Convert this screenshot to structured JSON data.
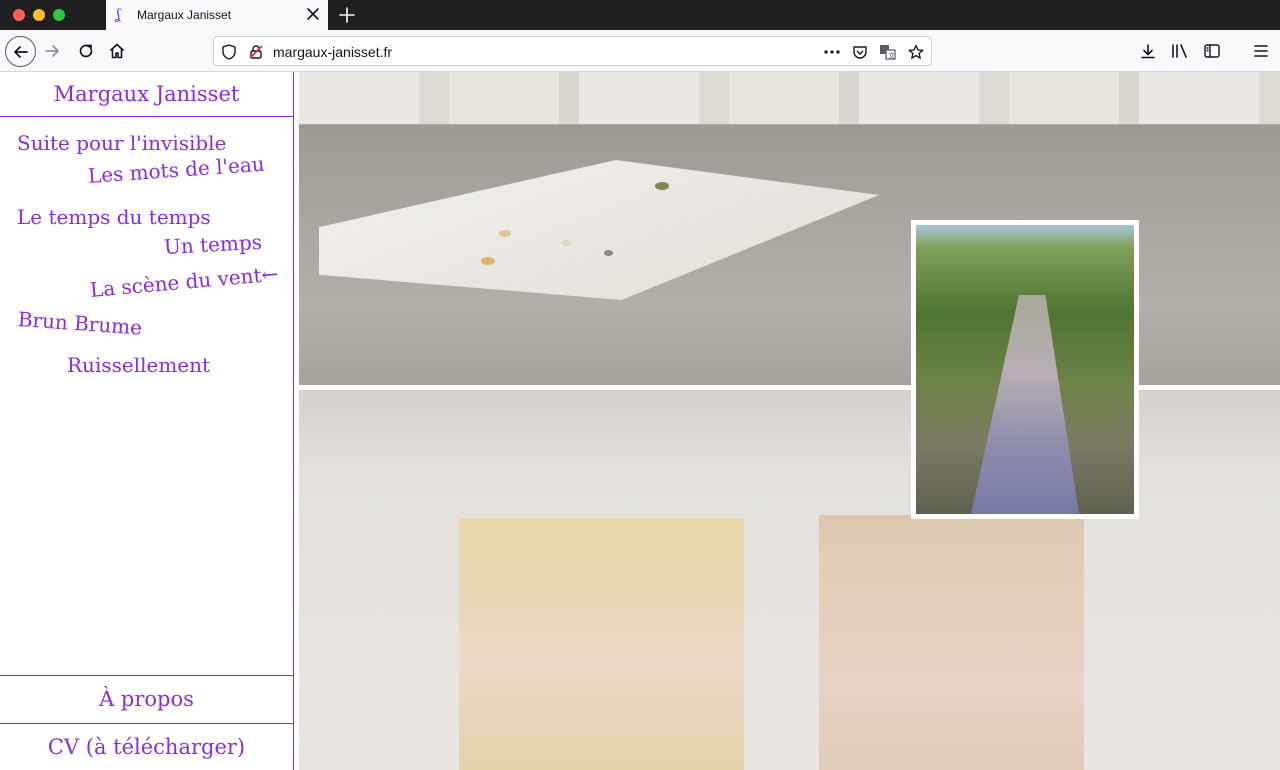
{
  "browser": {
    "tab_title": "Margaux Janisset",
    "url": "margaux-janisset.fr"
  },
  "site": {
    "title": "Margaux Janisset",
    "menu": [
      "Suite pour l'invisible",
      "Les mots de l'eau",
      "Le temps du temps",
      "Un temps",
      "La scène du vent←",
      "Brun Brume",
      "Ruissellement"
    ],
    "about": "À propos",
    "cv": "CV (à télécharger)"
  },
  "colors": {
    "accent": "#8a2be2",
    "chrome_dark": "#1f1f21",
    "chrome_light": "#f9f9fb"
  },
  "icons": [
    "back-icon",
    "forward-icon",
    "reload-icon",
    "home-icon",
    "shield-icon",
    "insecure-lock-icon",
    "more-icon",
    "pocket-icon",
    "translate-icon",
    "star-icon",
    "download-icon",
    "library-icon",
    "sidebar-icon",
    "menu-icon",
    "close-icon",
    "plus-icon"
  ]
}
